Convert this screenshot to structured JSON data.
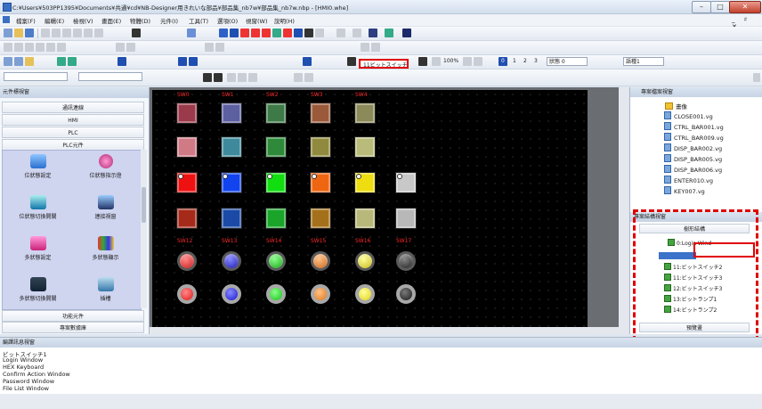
{
  "window": {
    "title": "C:¥Users¥503PP1395¥Documents¥共通¥cd¥NB-Designer用きれいな部品¥部品集_nb7w¥部品集_nb7w.nbp - [HMI0.whe]",
    "minimize": "–",
    "maximize": "□",
    "close": "✕",
    "doc_controls": "_ ♯ ✕"
  },
  "menu": [
    "檔案(F)",
    "編輯(E)",
    "檢視(V)",
    "畫面(E)",
    "物體(D)",
    "元件(I)",
    "工具(T)",
    "選項(O)",
    "視窗(W)",
    "說明(H)"
  ],
  "toolbar": {
    "bit_switch": "11ビットスイッチ",
    "zoom": "100%",
    "state_label": "狀態 0",
    "layer_label": "語種1",
    "states": [
      "0",
      "1",
      "2",
      "3"
    ]
  },
  "left_panel": {
    "title": "元件標視窗",
    "categories": [
      "通訊連線",
      "HMI",
      "PLC",
      "PLC元件"
    ],
    "items": [
      "位狀態設定",
      "位狀態指示燈",
      "位狀態切換開關",
      "連接視窗",
      "多狀態設定",
      "多狀態顯示",
      "多狀態切換開關",
      "插槽"
    ],
    "bottom_tabs": [
      "功能元件",
      "專案數據庫"
    ]
  },
  "canvas": {
    "switch_labels_row1": [
      "SW0",
      "SW1",
      "SW2",
      "SW3",
      "SW4"
    ],
    "switch_labels_row2": [
      "SW12",
      "SW13",
      "SW14",
      "SW15",
      "SW16",
      "SW17"
    ]
  },
  "right_top": {
    "title": "專案檔案視窗",
    "root": "畫像",
    "files": [
      "CLOSE001.vg",
      "CTRL_BAR001.vg",
      "CTRL_BAR009.vg",
      "DISP_BAR002.vg",
      "DISP_BAR005.vg",
      "DISP_BAR006.vg",
      "ENTER010.vg",
      "KEY007.vg"
    ]
  },
  "right_bottom": {
    "title": "專案結構視窗",
    "structure_tab": "樹形結構",
    "top_node": "0:Login Wind",
    "nodes": [
      "11:ビットスイッチ2",
      "11:ビットスイッチ3",
      "12:ビットスイッチ3",
      "13:ビットランプ1",
      "14:ビットランプ2"
    ],
    "preview_tab": "預覽畫"
  },
  "output": {
    "title": "編譯訊息視窗",
    "lines": [
      "ビットスイッチ1",
      "Login Window",
      "HEX Keyboard",
      "Confirm Action Window",
      "Password Window",
      "File List Window"
    ]
  },
  "colors": {
    "switch_red": "#e00000",
    "dashed_red": "#e00000",
    "canvas_bg": "#000000"
  }
}
